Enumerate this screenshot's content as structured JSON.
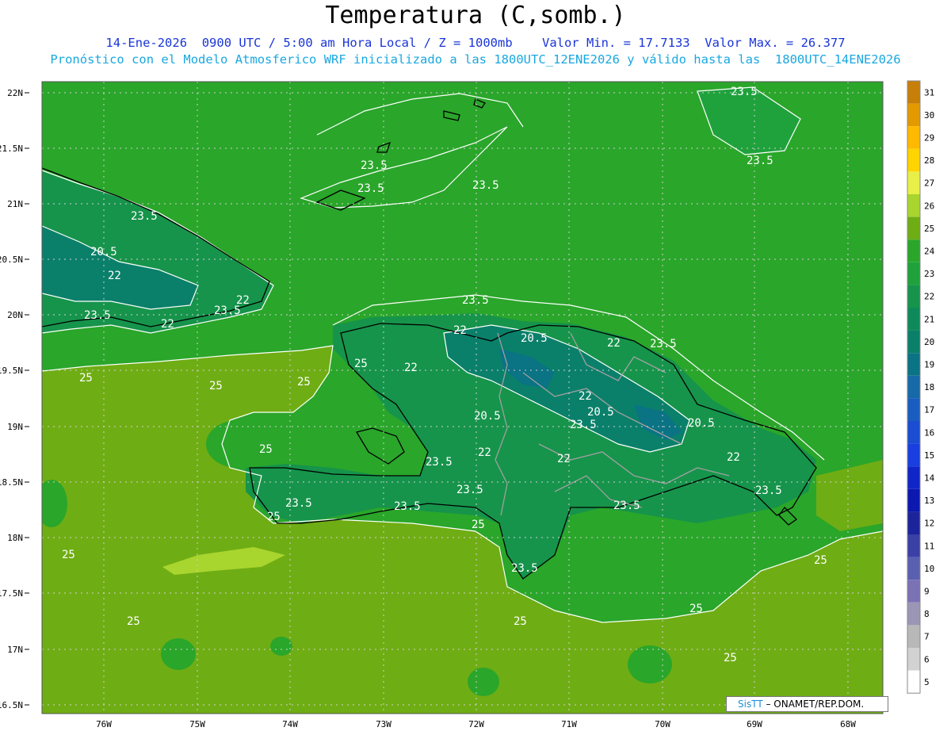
{
  "header": {
    "title": "Temperatura (C,somb.)",
    "line1": "14-Ene-2026  0900 UTC / 5:00 am Hora Local / Z = 1000mb    Valor Min. = 17.7133  Valor Max. = 26.377",
    "line2": "Pronóstico con el Modelo Atmosferico WRF inicializado a las 1800UTC_12ENE2026 y válido hasta las  1800UTC_14ENE2026"
  },
  "map": {
    "lat_labels": [
      "22N",
      "21.5N",
      "21N",
      "20.5N",
      "20N",
      "19.5N",
      "19N",
      "18.5N",
      "18N",
      "17.5N",
      "17N",
      "16.5N"
    ],
    "lon_labels": [
      "76W",
      "75W",
      "74W",
      "73W",
      "72W",
      "71W",
      "70W",
      "69W",
      "68W"
    ],
    "contour_labels": [
      {
        "text": "23.5",
        "id": "c1"
      },
      {
        "text": "23.5",
        "id": "c2"
      },
      {
        "text": "23.5",
        "id": "c3"
      },
      {
        "text": "23.5",
        "id": "c4"
      },
      {
        "text": "23.5",
        "id": "c5"
      },
      {
        "text": "20.5",
        "id": "c6"
      },
      {
        "text": "22",
        "id": "c7"
      },
      {
        "text": "23.5",
        "id": "c8"
      },
      {
        "text": "22",
        "id": "c9"
      },
      {
        "text": "22",
        "id": "c10"
      },
      {
        "text": "23.5",
        "id": "c11"
      },
      {
        "text": "23.5",
        "id": "c12"
      },
      {
        "text": "22",
        "id": "c13"
      },
      {
        "text": "20.5",
        "id": "c14"
      },
      {
        "text": "22",
        "id": "c15"
      },
      {
        "text": "23.5",
        "id": "c16"
      },
      {
        "text": "23.5",
        "id": "c17"
      },
      {
        "text": "22",
        "id": "c18"
      },
      {
        "text": "25",
        "id": "c19"
      },
      {
        "text": "25",
        "id": "c20"
      },
      {
        "text": "25",
        "id": "c21"
      },
      {
        "text": "20.5",
        "id": "c22"
      },
      {
        "text": "20.5",
        "id": "c23"
      },
      {
        "text": "22",
        "id": "c24"
      },
      {
        "text": "23.5",
        "id": "c25"
      },
      {
        "text": "20.5",
        "id": "c26"
      },
      {
        "text": "22",
        "id": "c27"
      },
      {
        "text": "22",
        "id": "c28"
      },
      {
        "text": "22",
        "id": "c29"
      },
      {
        "text": "25",
        "id": "c30"
      },
      {
        "text": "23.5",
        "id": "c31"
      },
      {
        "text": "23.5",
        "id": "c32"
      },
      {
        "text": "23.5",
        "id": "c33"
      },
      {
        "text": "25",
        "id": "c34"
      },
      {
        "text": "23.5",
        "id": "c35"
      },
      {
        "text": "23.5",
        "id": "c36"
      },
      {
        "text": "23.5",
        "id": "c37"
      },
      {
        "text": "25",
        "id": "c38"
      },
      {
        "text": "25",
        "id": "c39"
      },
      {
        "text": "23.5",
        "id": "c40"
      },
      {
        "text": "25",
        "id": "c41"
      },
      {
        "text": "25",
        "id": "c42"
      },
      {
        "text": "25",
        "id": "c43"
      },
      {
        "text": "25",
        "id": "c44"
      },
      {
        "text": "25",
        "id": "c45"
      },
      {
        "text": "25",
        "id": "c46"
      }
    ]
  },
  "legend": {
    "values": [
      "31",
      "30",
      "29",
      "28",
      "27",
      "26",
      "25",
      "24",
      "23",
      "22",
      "21",
      "20",
      "19",
      "18",
      "17",
      "16",
      "15",
      "14",
      "13",
      "12",
      "11",
      "10",
      "9",
      "8",
      "7",
      "6",
      "5"
    ],
    "colors": [
      "#c77f0a",
      "#e29a00",
      "#ffb900",
      "#ffd400",
      "#e8f048",
      "#a8d52e",
      "#6fad14",
      "#2aa62a",
      "#1fa23c",
      "#16944b",
      "#0e8a5a",
      "#0a806a",
      "#0a7384",
      "#166aa7",
      "#1a5dc0",
      "#1a4dd2",
      "#1a3fe0",
      "#1025c8",
      "#0c18b0",
      "#1c249c",
      "#3a40a6",
      "#5a60b0",
      "#7a72b4",
      "#9c96b6",
      "#b8b8b8",
      "#d2d2d2",
      "#ffffff"
    ]
  },
  "credit": {
    "sis": "SisTT",
    "rest": " – ONAMET/REP.DOM."
  },
  "colors": {
    "sea_warm": "#6fad14",
    "sea_mid": "#2aa62a",
    "land_cool": "#16944b",
    "land_cold": "#0a7384"
  }
}
